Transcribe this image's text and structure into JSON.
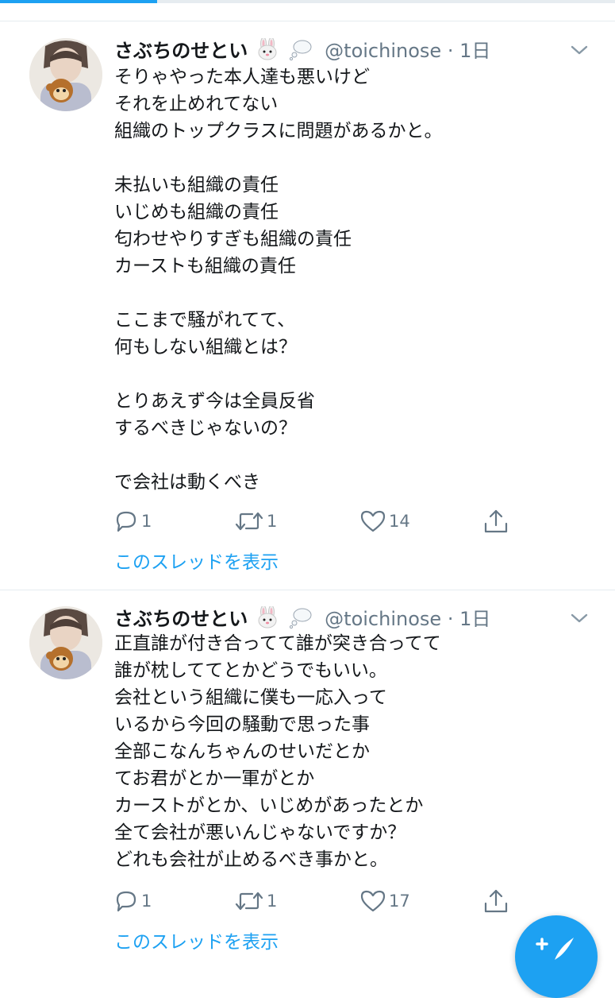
{
  "tweets": [
    {
      "name": "さぶちのせとい",
      "emoji": [
        "rabbit-face-icon",
        "thought-balloon-icon"
      ],
      "handle": "@toichinose",
      "separator": "·",
      "time": "1日",
      "text": "そりゃやった本人達も悪いけど\nそれを止めれてない\n組織のトップクラスに問題があるかと。\n\n未払いも組織の責任\nいじめも組織の責任\n匂わせやりすぎも組織の責任\nカーストも組織の責任\n\nここまで騒がれてて、\n何もしない組織とは？\n\nとりあえず今は全員反省\nするべきじゃないの？\n\nで会社は動くべき",
      "reply_count": "1",
      "retweet_count": "1",
      "like_count": "14",
      "thread_link": "このスレッドを表示"
    },
    {
      "name": "さぶちのせとい",
      "emoji": [
        "rabbit-face-icon",
        "thought-balloon-icon"
      ],
      "handle": "@toichinose",
      "separator": "·",
      "time": "1日",
      "text": "正直誰が付き合ってて誰が突き合ってて\n誰が枕しててとかどうでもいい。\n会社という組織に僕も一応入って\nいるから今回の騒動で思った事\n全部こなんちゃんのせいだとか\nてお君がとか一軍がとか\nカーストがとか、いじめがあったとか\n全て会社が悪いんじゃないですか？\nどれも会社が止めるべき事かと。",
      "reply_count": "1",
      "retweet_count": "1",
      "like_count": "17",
      "thread_link": "このスレッドを表示"
    }
  ],
  "icons": [
    "reply-icon",
    "retweet-icon",
    "like-icon",
    "share-icon",
    "chevron-down-icon",
    "compose-tweet-icon"
  ],
  "colors": {
    "accent": "#1da1f2",
    "text": "#14171a",
    "secondary": "#657786",
    "divider": "#e6ecf0"
  }
}
